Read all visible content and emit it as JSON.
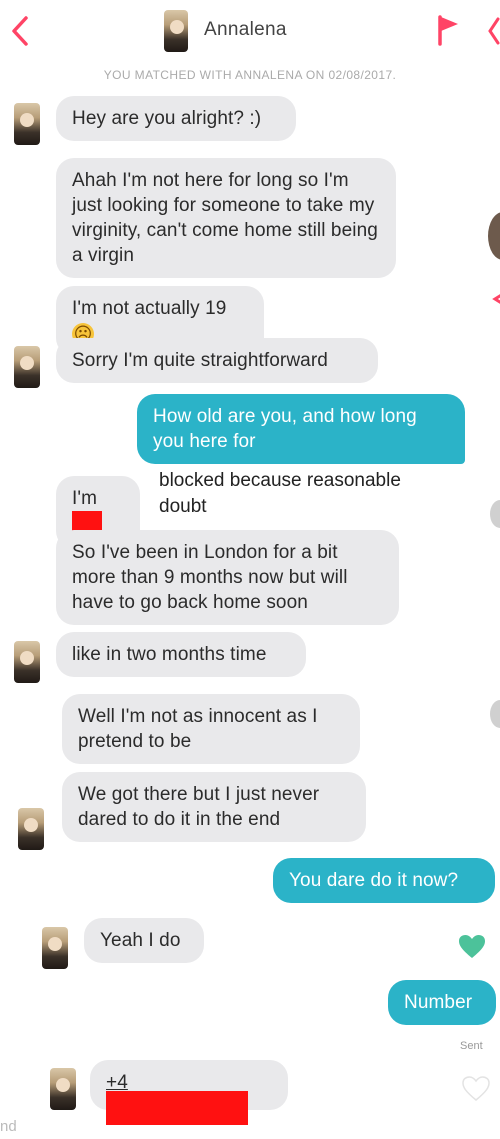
{
  "header": {
    "contact_name": "Annalena",
    "back_icon": "chevron-left-icon",
    "flag_icon": "flag-icon",
    "accent_color": "#ff4466"
  },
  "match_banner": "YOU MATCHED WITH ANNALENA ON 02/08/2017.",
  "messages": [
    {
      "from": "them",
      "text": "Hey are you alright? :)"
    },
    {
      "from": "them",
      "text": "Ahah I'm not here for long so I'm just looking for someone to take my virginity, can't come home still being a virgin"
    },
    {
      "from": "them",
      "text": "I'm not actually 19",
      "emoji": "☹"
    },
    {
      "from": "them",
      "text": "Sorry I'm quite straightforward"
    },
    {
      "from": "me",
      "text": "How old are you, and how long you here for"
    },
    {
      "from": "them",
      "text": "I'm"
    },
    {
      "from": "them",
      "text": "So I've been in London for a bit more than 9 months now but will have to go back home soon"
    },
    {
      "from": "them",
      "text": "like in two months time"
    },
    {
      "from": "them",
      "text": "Well I'm not as innocent as I pretend to be"
    },
    {
      "from": "them",
      "text": "We got there but I just never dared to do it in the end"
    },
    {
      "from": "me",
      "text": "You dare do it now?"
    },
    {
      "from": "them",
      "text": "Yeah I do"
    },
    {
      "from": "me",
      "text": "Number"
    },
    {
      "from": "them",
      "text": "+4"
    }
  ],
  "annotation": "blocked because reasonable doubt",
  "status": {
    "sent": "Sent"
  },
  "edge_text": "nd",
  "colors": {
    "sent_bubble": "#2bb3c8",
    "received_bubble": "#e9e9eb",
    "redaction": "#ff1111",
    "heart": "#4cc29a"
  }
}
